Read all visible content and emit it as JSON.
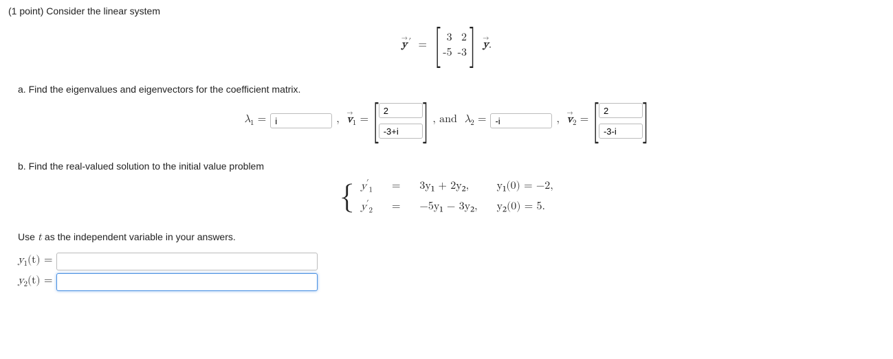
{
  "header": {
    "points": "(1 point)",
    "prompt": "Consider the linear system"
  },
  "matrix_eq": {
    "lhs": "y",
    "rows": [
      [
        "3",
        "2"
      ],
      [
        "-5",
        "-3"
      ]
    ]
  },
  "partA": {
    "label": "a.",
    "text": "Find the eigenvalues and eigenvectors for the coefficient matrix.",
    "lambda1_sym": "λ",
    "lambda1_sub": "1",
    "lambda1_val": "i",
    "v1_sym": "v",
    "v1_sub": "1",
    "v1_top": "2",
    "v1_bot": "-3+i",
    "mid": ", and",
    "lambda2_sym": "λ",
    "lambda2_sub": "2",
    "lambda2_val": "-i",
    "v2_sym": "v",
    "v2_sub": "2",
    "v2_top": "2",
    "v2_bot": "-3-i"
  },
  "partB": {
    "label": "b.",
    "text": "Find the real-valued solution to the initial value problem",
    "rows": [
      {
        "lhs_base": "y",
        "lhs_sub": "1",
        "eq": "=",
        "rhs": "3y₁ + 2y₂,",
        "ic": "y₁(0) = −2,"
      },
      {
        "lhs_base": "y",
        "lhs_sub": "2",
        "eq": "=",
        "rhs": "−5y₁ − 3y₂,",
        "ic": "y₂(0) = 5."
      }
    ],
    "note": "Use t as the independent variable in your answers.",
    "ans1_label_base": "y",
    "ans1_label_sub": "1",
    "ans1_arg": "(t)",
    "ans1_val": "",
    "ans2_label_base": "y",
    "ans2_label_sub": "2",
    "ans2_arg": "(t)",
    "ans2_val": ""
  }
}
